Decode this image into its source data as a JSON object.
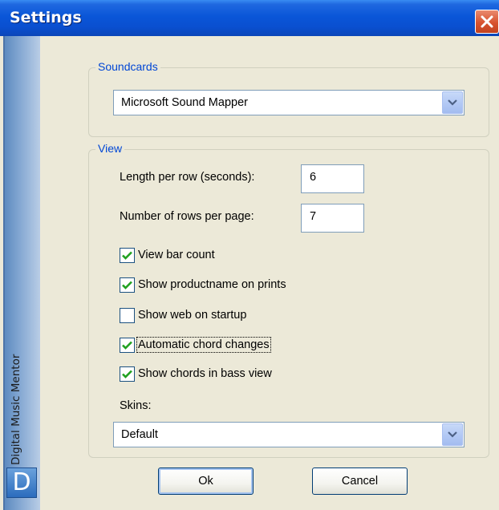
{
  "window": {
    "title": "Settings",
    "sidebar_label": "Digital Music Mentor",
    "logo_letter": "D",
    "close_icon": "close-x-icon",
    "accent_color": "#0a56d8",
    "close_color": "#d8532f"
  },
  "soundcards": {
    "legend": "Soundcards",
    "selected": "Microsoft Sound Mapper"
  },
  "view": {
    "legend": "View",
    "length_label": "Length per row (seconds):",
    "length_value": "6",
    "rows_label": "Number of rows per page:",
    "rows_value": "7",
    "checkboxes": [
      {
        "label": "View bar count",
        "checked": true
      },
      {
        "label": "Show productname on prints",
        "checked": true
      },
      {
        "label": "Show web on startup",
        "checked": false
      },
      {
        "label": "Automatic chord changes",
        "checked": true
      },
      {
        "label": "Show chords in bass view",
        "checked": true
      }
    ],
    "skins_label": "Skins:",
    "skins_selected": "Default"
  },
  "buttons": {
    "ok": "Ok",
    "cancel": "Cancel"
  }
}
